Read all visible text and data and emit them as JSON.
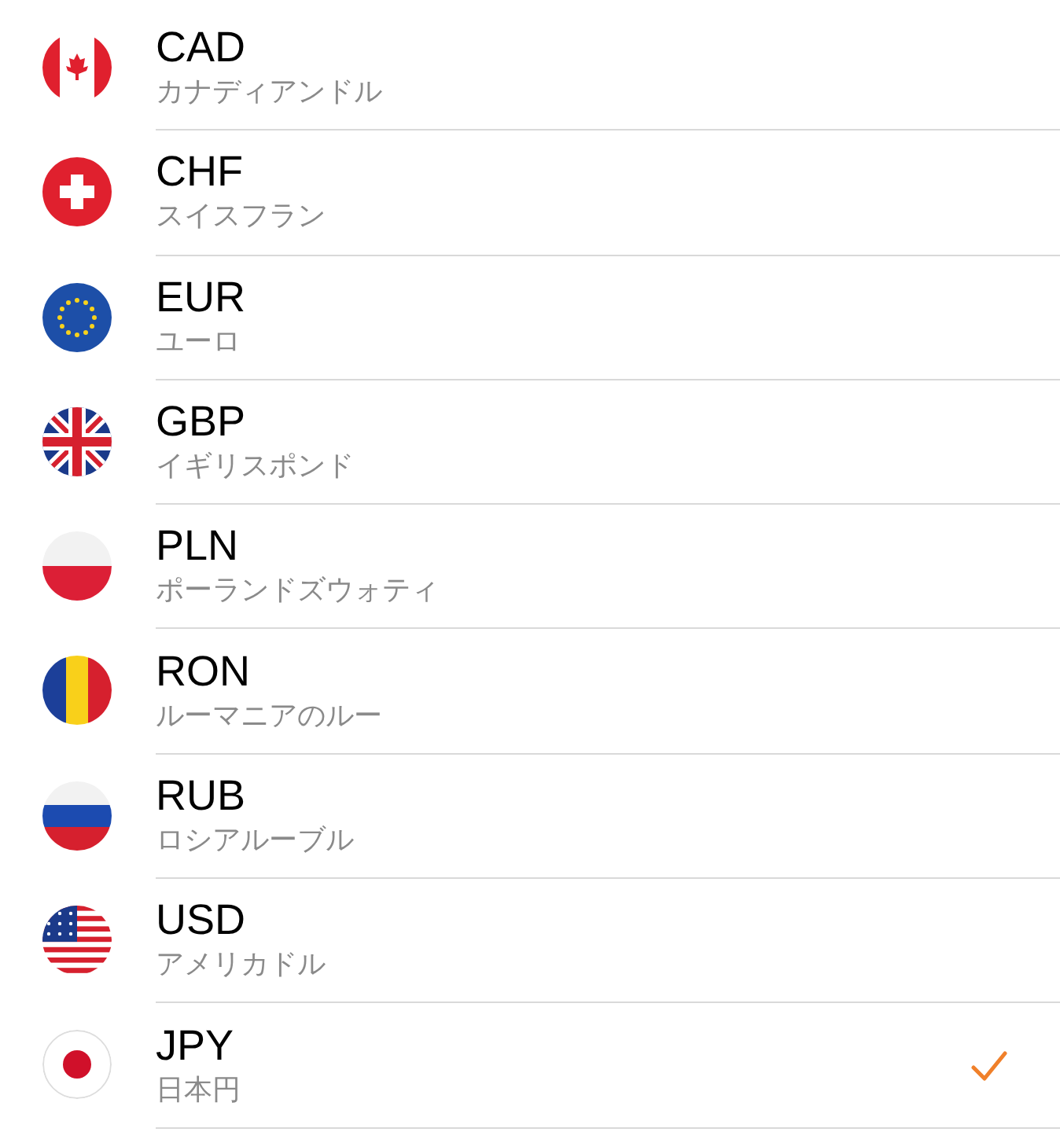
{
  "currencies": [
    {
      "code": "CAD",
      "name": "カナディアンドル",
      "kind": "canada",
      "selected": false
    },
    {
      "code": "CHF",
      "name": "スイスフラン",
      "kind": "switzerland",
      "selected": false
    },
    {
      "code": "EUR",
      "name": "ユーロ",
      "kind": "eu",
      "selected": false
    },
    {
      "code": "GBP",
      "name": "イギリスポンド",
      "kind": "uk",
      "selected": false
    },
    {
      "code": "PLN",
      "name": "ポーランドズウォティ",
      "kind": "poland",
      "selected": false
    },
    {
      "code": "RON",
      "name": "ルーマニアのルー",
      "kind": "romania",
      "selected": false
    },
    {
      "code": "RUB",
      "name": "ロシアルーブル",
      "kind": "russia",
      "selected": false
    },
    {
      "code": "USD",
      "name": "アメリカドル",
      "kind": "usa",
      "selected": false
    },
    {
      "code": "JPY",
      "name": "日本円",
      "kind": "japan",
      "selected": true
    }
  ]
}
